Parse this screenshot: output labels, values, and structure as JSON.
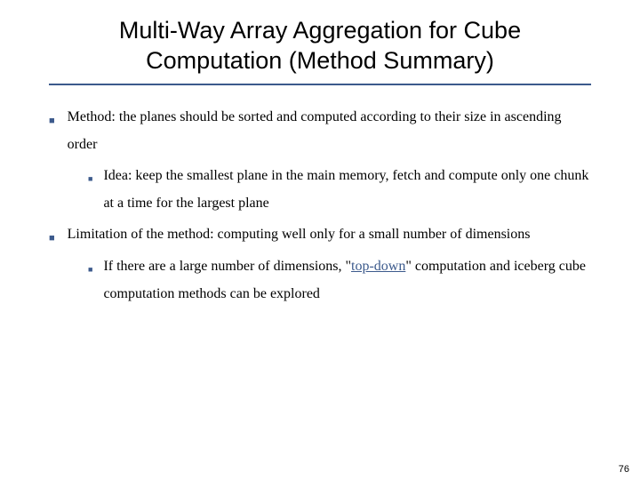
{
  "slide": {
    "title": "Multi-Way Array Aggregation for Cube Computation (Method Summary)",
    "bullets": {
      "b1": "Method: the planes should be sorted and computed according to their size in ascending order",
      "b1_1": "Idea: keep the smallest plane in the main memory, fetch and compute only one chunk at a time for the largest plane",
      "b2": "Limitation of the method: computing well only for a small number of dimensions",
      "b2_1_pre": "If there are a large number of dimensions, \"",
      "b2_1_link": "top-down",
      "b2_1_post": "\" computation and iceberg cube computation methods can be explored"
    },
    "page_number": "76"
  }
}
